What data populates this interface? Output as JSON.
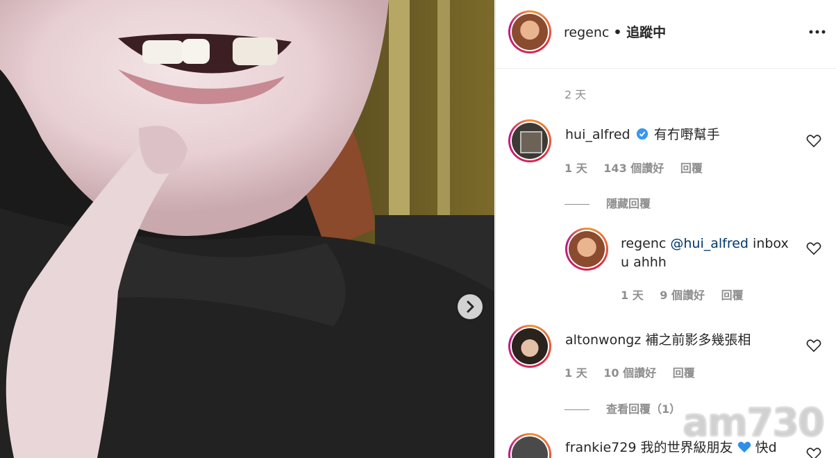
{
  "post": {
    "username": "regenc",
    "follow_status": "• 追蹤中",
    "time_ago": "2 天"
  },
  "comments": [
    {
      "username": "hui_alfred",
      "verified": true,
      "text": "有冇嘢幫手",
      "time": "1 天",
      "likes": "143 個讚好",
      "reply_label": "回覆",
      "toggle_label": "隱藏回覆",
      "replies": [
        {
          "username": "regenc",
          "mention": "@hui_alfred",
          "text_line1": " inbox",
          "text_line2": "u ahhh",
          "time": "1 天",
          "likes": "9 個讚好",
          "reply_label": "回覆"
        }
      ]
    },
    {
      "username": "altonwongz",
      "text": "補之前影多幾張相",
      "time": "1 天",
      "likes": "10 個讚好",
      "reply_label": "回覆",
      "toggle_label": "查看回覆（1）"
    },
    {
      "username": "frankie729",
      "text": "我的世界級朋友",
      "text_suffix": "快d"
    }
  ],
  "watermark": "am730",
  "colors": {
    "accent": "#0095f6",
    "verified": "#3897f0",
    "link": "#00376b",
    "muted": "#8e8e8e"
  },
  "icons": [
    "more-options-icon",
    "heart-icon",
    "verified-badge-icon",
    "chevron-right-icon",
    "blue-heart-emoji"
  ]
}
